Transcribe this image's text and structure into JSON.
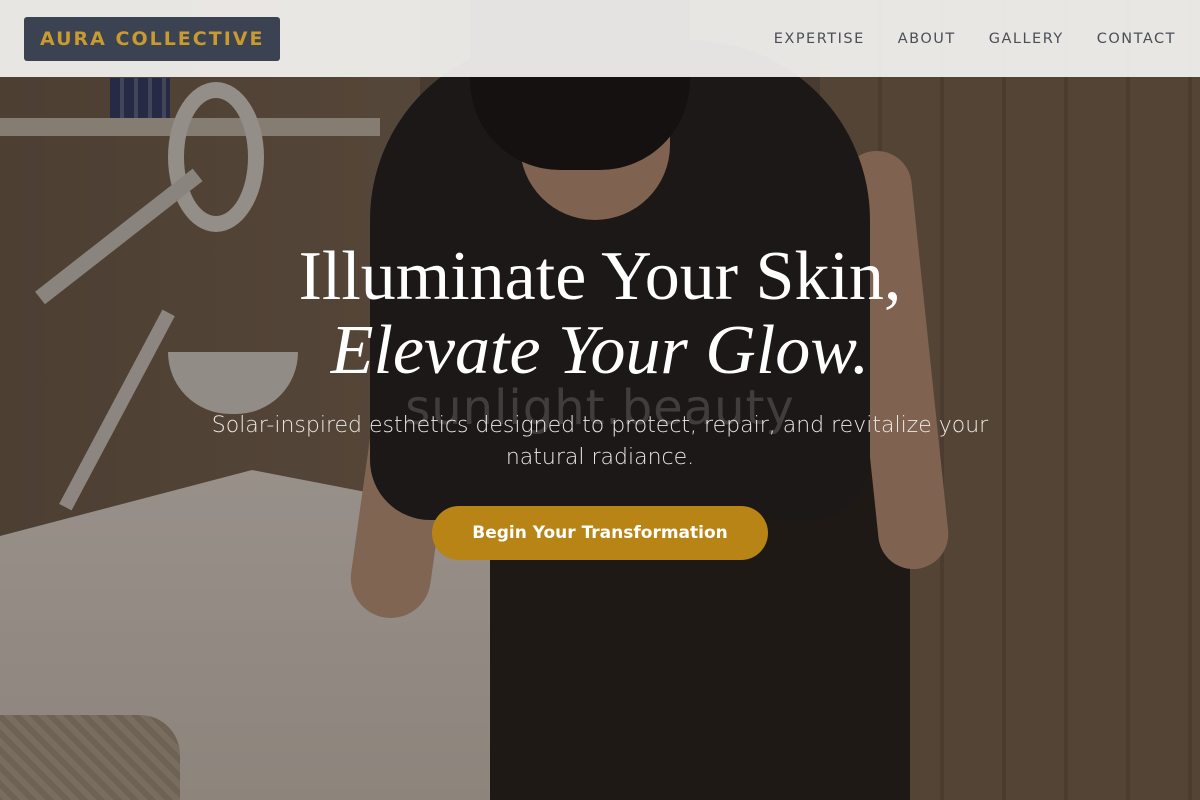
{
  "brand": {
    "name": "AURA COLLECTIVE"
  },
  "nav": {
    "items": [
      "EXPERTISE",
      "ABOUT",
      "GALLERY",
      "CONTACT"
    ]
  },
  "hero": {
    "headline_line1": "Illuminate Your Skin,",
    "headline_line2": "Elevate Your Glow.",
    "watermark": "sunlight.beauty",
    "subtitle": "Solar-inspired esthetics designed to protect, repair, and revitalize your natural radiance.",
    "cta_label": "Begin Your Transformation"
  },
  "colors": {
    "brand_background": "#3b4252",
    "brand_text": "#c99a2e",
    "cta_background": "#b88416",
    "nav_text": "#4a4f57"
  }
}
